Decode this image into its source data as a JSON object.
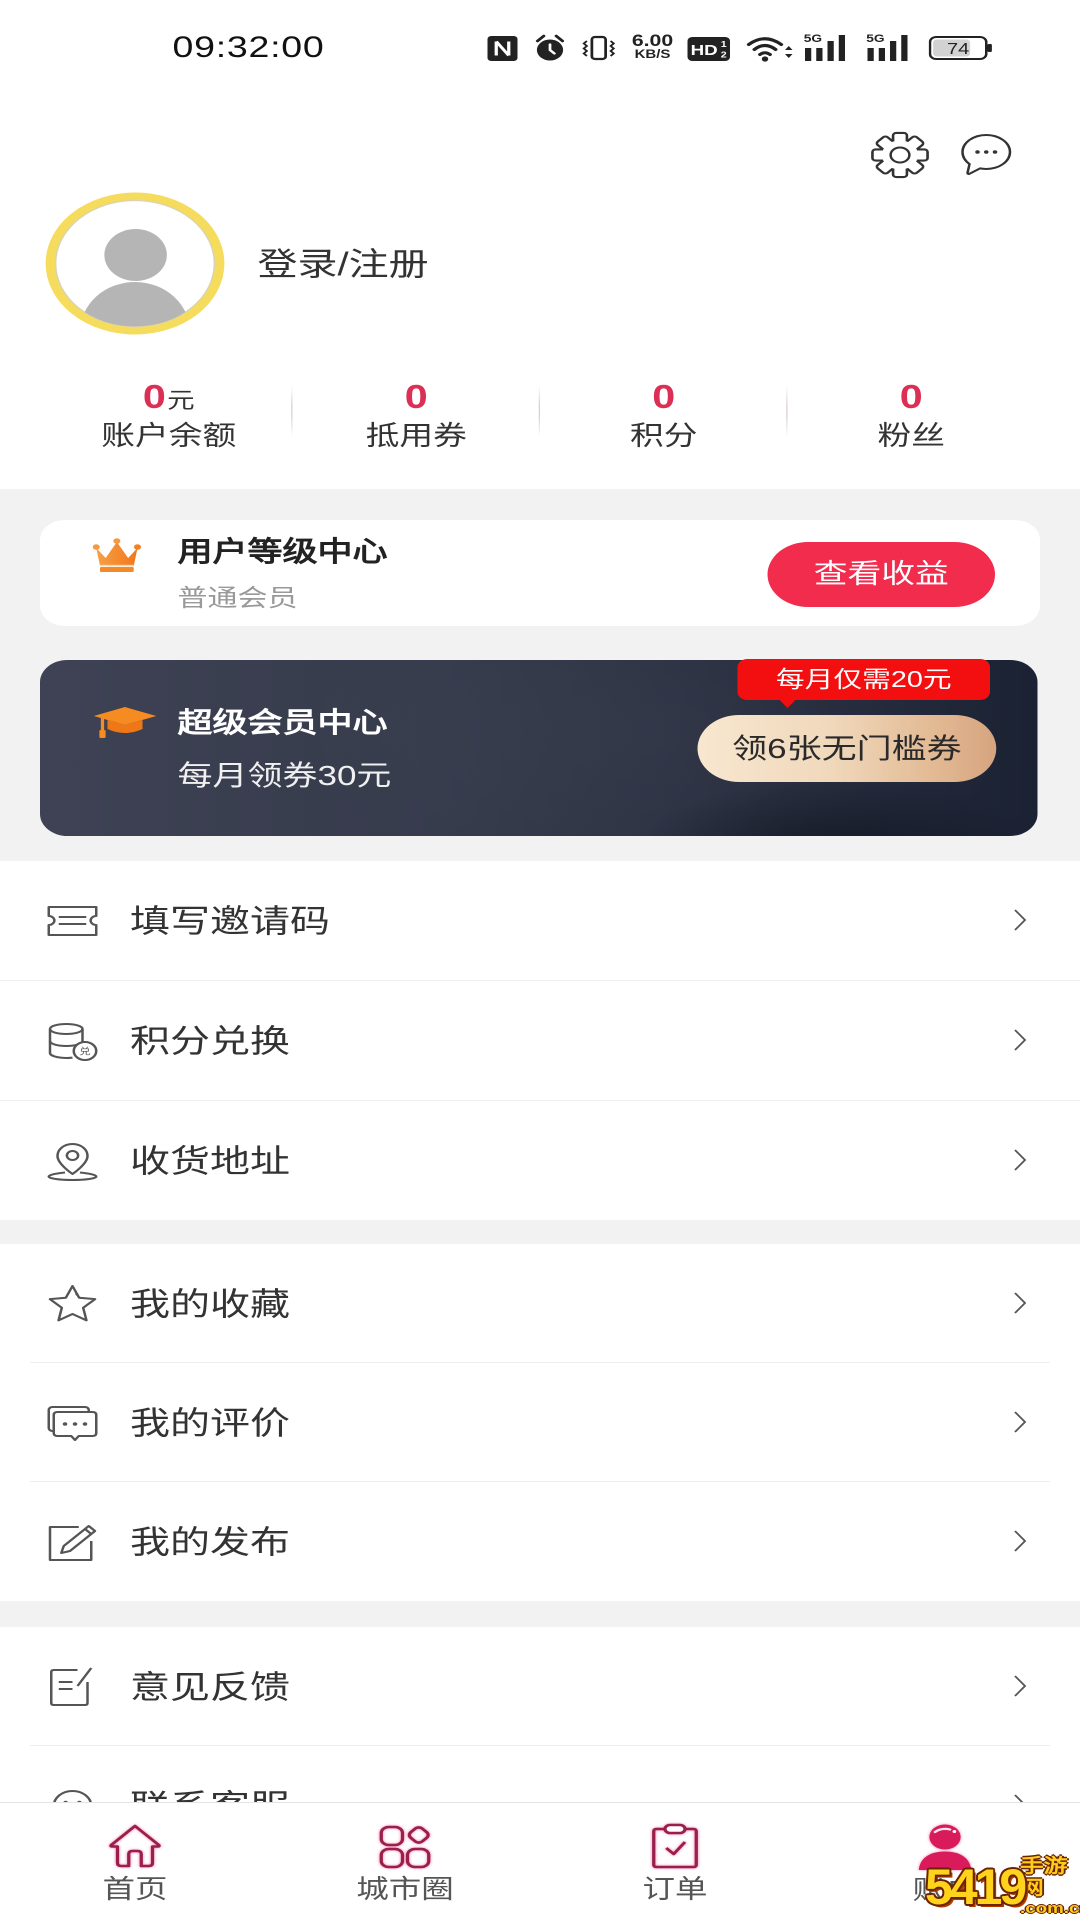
{
  "status_bar": {
    "time": "09:32:00",
    "nfc_icon": "nfc-icon",
    "alarm_icon": "alarm-icon",
    "vibrate_icon": "vibrate-icon",
    "net_speed": "6.00",
    "net_speed_unit": "KB/S",
    "hd_label": "HD",
    "hd_sup": "1",
    "hd_sub": "2",
    "wifi_icon": "wifi-icon",
    "signal_1_label": "5G",
    "signal_2_label": "5G",
    "battery": "74"
  },
  "header": {
    "settings_icon": "gear-icon",
    "messages_icon": "chat-bubble-icon"
  },
  "profile": {
    "avatar_icon": "default-avatar-icon",
    "login_label": "登录/注册"
  },
  "stats": [
    {
      "value": "0",
      "unit": "元",
      "label": "账户余额"
    },
    {
      "value": "0",
      "label": "抵用券"
    },
    {
      "value": "0",
      "label": "积分"
    },
    {
      "value": "0",
      "label": "粉丝"
    }
  ],
  "level_card": {
    "icon": "crown-icon",
    "title": "用户等级中心",
    "subtitle": "普通会员",
    "button": "查看收益"
  },
  "super_card": {
    "icon": "graduation-cap-icon",
    "title": "超级会员中心",
    "subtitle": "每月领券30元",
    "price_tag": "每月仅需20元",
    "button": "领6张无门槛券"
  },
  "menu_groups": [
    {
      "items": [
        {
          "icon": "ticket-icon",
          "label": "填写邀请码"
        },
        {
          "icon": "points-exchange-icon",
          "icon_text": "兑",
          "label": "积分兑换"
        },
        {
          "icon": "location-pin-icon",
          "label": "收货地址"
        }
      ]
    },
    {
      "items": [
        {
          "icon": "star-icon",
          "label": "我的收藏"
        },
        {
          "icon": "comments-icon",
          "label": "我的评价"
        },
        {
          "icon": "edit-icon",
          "label": "我的发布"
        }
      ]
    },
    {
      "items": [
        {
          "icon": "feedback-icon",
          "label": "意见反馈"
        },
        {
          "icon": "customer-service-icon",
          "label": "联系客服"
        }
      ]
    }
  ],
  "chevron_icon": "chevron-right-icon",
  "tabbar": {
    "active_index": 3,
    "items": [
      {
        "icon": "home-icon",
        "label": "首页"
      },
      {
        "icon": "city-circle-icon",
        "label": "城市圈"
      },
      {
        "icon": "orders-icon",
        "label": "订单"
      },
      {
        "icon": "account-icon",
        "label": "账户"
      }
    ]
  },
  "watermark": {
    "number": "5419",
    "site": "手游网",
    "domain": ".com.cn"
  },
  "colors": {
    "accent": "#dc2f55",
    "btn_red": "#f22c4d",
    "tag_red": "#f30f10",
    "tab_stroke": "#9a1f4c",
    "tab_active": "#d91a5b",
    "ring": "#f5dc5c"
  }
}
